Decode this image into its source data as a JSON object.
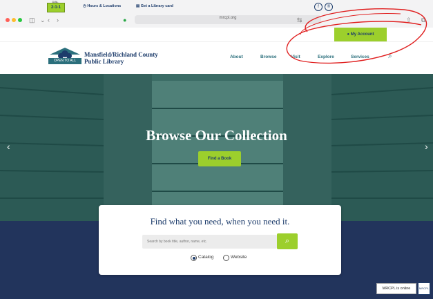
{
  "browser": {
    "url": "mrcpl.org",
    "colors": {
      "red": "#ff5f57",
      "yellow": "#febc2e",
      "green": "#28c840"
    }
  },
  "utility_bar": {
    "badge": "2-1-1",
    "badge_top": "DIAL",
    "hours_link": "Hours & Locations",
    "card_link": "Get a Library card",
    "facebook_icon": "f",
    "pinterest_icon": "®",
    "account_button": "My Account"
  },
  "header": {
    "logo_tag": "OPEN TO ALL",
    "name_line1": "Mansfield/Richland County",
    "name_line2": "Public Library",
    "nav": [
      "About",
      "Browse",
      "Visit",
      "Explore",
      "Services"
    ]
  },
  "hero": {
    "title": "Browse Our Collection",
    "button": "Find a Book",
    "prev": "‹",
    "next": "›"
  },
  "search": {
    "title": "Find what you need, when you need it.",
    "placeholder": "Search by book title, author, name, etc.",
    "options": [
      "Catalog",
      "Website"
    ],
    "selected": "Catalog"
  },
  "widget": {
    "status": "MRCPL is online",
    "logo_text": "MRCPL"
  },
  "colors": {
    "brand_green": "#9ccf2c",
    "navy": "#1d3c6b",
    "teal": "#2b6f7c",
    "annotation": "#e02020"
  }
}
